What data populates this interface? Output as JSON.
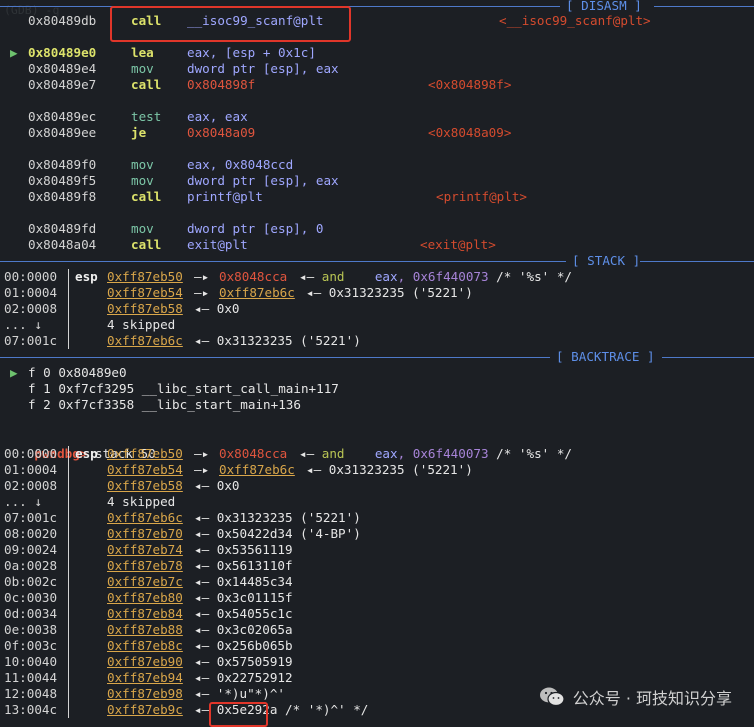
{
  "separators": {
    "disasm": "[ DISASM ]",
    "stack": "[ STACK ]",
    "backtrace": "[ BACKTRACE ]"
  },
  "disasm": [
    {
      "marker": "",
      "addr": "0x80489db",
      "op": "call",
      "arg": "__isoc99_scanf@plt",
      "target": "<__isoc99_scanf@plt>"
    },
    {
      "marker": "▶",
      "addr": "0x80489e0",
      "op": "lea",
      "arg": "eax, [esp + 0x1c]",
      "target": ""
    },
    {
      "marker": "",
      "addr": "0x80489e4",
      "op": "mov",
      "arg": "dword ptr [esp], eax",
      "target": ""
    },
    {
      "marker": "",
      "addr": "0x80489e7",
      "op": "call",
      "arg": "0x804898f",
      "target": "<0x804898f>"
    },
    {
      "marker": "",
      "addr": "0x80489ec",
      "op": "test",
      "arg": "eax, eax",
      "target": ""
    },
    {
      "marker": "",
      "addr": "0x80489ee",
      "op": "je",
      "arg": "0x8048a09",
      "target": "<0x8048a09>"
    },
    {
      "marker": "",
      "addr": "0x80489f0",
      "op": "mov",
      "arg": "eax, 0x8048ccd",
      "target": ""
    },
    {
      "marker": "",
      "addr": "0x80489f5",
      "op": "mov",
      "arg": "dword ptr [esp], eax",
      "target": ""
    },
    {
      "marker": "",
      "addr": "0x80489f8",
      "op": "call",
      "arg": "printf@plt",
      "target": "<printf@plt>"
    },
    {
      "marker": "",
      "addr": "0x80489fd",
      "op": "mov",
      "arg": "dword ptr [esp], 0",
      "target": ""
    },
    {
      "marker": "",
      "addr": "0x8048a04",
      "op": "call",
      "arg": "exit@plt",
      "target": "<exit@plt>"
    }
  ],
  "stack1": [
    {
      "idx": "00:0000",
      "reg": "esp",
      "addr": "0xff87eb50",
      "rest1": "—▸",
      "ptr": "0x8048cca",
      "rest2": "◂— and    eax, 0x6f440073 /* '%s' */"
    },
    {
      "idx": "01:0004",
      "reg": "",
      "addr": "0xff87eb54",
      "rest1": "—▸",
      "ptr": "0xff87eb6c",
      "rest2": "◂— 0x31323235 ('5221')"
    },
    {
      "idx": "02:0008",
      "reg": "",
      "addr": "0xff87eb58",
      "rest1": "◂— 0x0",
      "ptr": "",
      "rest2": ""
    },
    {
      "idx": "... ↓",
      "reg": "",
      "addr": "",
      "rest1": "4 skipped",
      "ptr": "",
      "rest2": ""
    },
    {
      "idx": "07:001c",
      "reg": "",
      "addr": "0xff87eb6c",
      "rest1": "◂— 0x31323235 ('5221')",
      "ptr": "",
      "rest2": ""
    }
  ],
  "backtrace": [
    {
      "marker": "▶",
      "text": "f 0 0x80489e0"
    },
    {
      "marker": "",
      "text": "f 1 0xf7cf3295 __libc_start_call_main+117"
    },
    {
      "marker": "",
      "text": "f 2 0xf7cf3358 __libc_start_main+136"
    }
  ],
  "prompt": {
    "name": "pwndbg>",
    "command": "stack 50"
  },
  "stack2": [
    {
      "idx": "00:0000",
      "reg": "esp",
      "addr": "0xff87eb50",
      "rest1": "—▸",
      "ptr": "0x8048cca",
      "rest2": "◂— and    eax, 0x6f440073 /* '%s' */"
    },
    {
      "idx": "01:0004",
      "reg": "",
      "addr": "0xff87eb54",
      "rest1": "—▸",
      "ptr": "0xff87eb6c",
      "rest2": "◂— 0x31323235 ('5221')"
    },
    {
      "idx": "02:0008",
      "reg": "",
      "addr": "0xff87eb58",
      "rest1": "◂— 0x0",
      "ptr": "",
      "rest2": ""
    },
    {
      "idx": "... ↓",
      "reg": "",
      "addr": "",
      "rest1": "4 skipped",
      "ptr": "",
      "rest2": ""
    },
    {
      "idx": "07:001c",
      "reg": "",
      "addr": "0xff87eb6c",
      "rest1": "◂— 0x31323235 ('5221')",
      "ptr": "",
      "rest2": ""
    },
    {
      "idx": "08:0020",
      "reg": "",
      "addr": "0xff87eb70",
      "rest1": "◂— 0x50422d34 ('4-BP')",
      "ptr": "",
      "rest2": ""
    },
    {
      "idx": "09:0024",
      "reg": "",
      "addr": "0xff87eb74",
      "rest1": "◂— 0x53561119",
      "ptr": "",
      "rest2": ""
    },
    {
      "idx": "0a:0028",
      "reg": "",
      "addr": "0xff87eb78",
      "rest1": "◂— 0x5613110f",
      "ptr": "",
      "rest2": ""
    },
    {
      "idx": "0b:002c",
      "reg": "",
      "addr": "0xff87eb7c",
      "rest1": "◂— 0x14485c34",
      "ptr": "",
      "rest2": ""
    },
    {
      "idx": "0c:0030",
      "reg": "",
      "addr": "0xff87eb80",
      "rest1": "◂— 0x3c01115f",
      "ptr": "",
      "rest2": ""
    },
    {
      "idx": "0d:0034",
      "reg": "",
      "addr": "0xff87eb84",
      "rest1": "◂— 0x54055c1c",
      "ptr": "",
      "rest2": ""
    },
    {
      "idx": "0e:0038",
      "reg": "",
      "addr": "0xff87eb88",
      "rest1": "◂— 0x3c02065a",
      "ptr": "",
      "rest2": ""
    },
    {
      "idx": "0f:003c",
      "reg": "",
      "addr": "0xff87eb8c",
      "rest1": "◂— 0x256b065b",
      "ptr": "",
      "rest2": ""
    },
    {
      "idx": "10:0040",
      "reg": "",
      "addr": "0xff87eb90",
      "rest1": "◂— 0x57505919",
      "ptr": "",
      "rest2": ""
    },
    {
      "idx": "11:0044",
      "reg": "",
      "addr": "0xff87eb94",
      "rest1": "◂— 0x22752912",
      "ptr": "",
      "rest2": ""
    },
    {
      "idx": "12:0048",
      "reg": "",
      "addr": "0xff87eb98",
      "rest1": "◂— '*)u\"*)^'",
      "ptr": "",
      "rest2": ""
    },
    {
      "idx": "13:004c",
      "reg": "",
      "addr": "0xff87eb9c",
      "rest1": "◂— 0x5e292a /* '*)^' */",
      "ptr": "",
      "rest2": ""
    }
  ],
  "watermark": {
    "text": "公众号 · 珂技知识分享"
  },
  "colors": {
    "highlight_box": "#e0362a",
    "separator": "#4e79c9",
    "background": "#1c1f24"
  }
}
